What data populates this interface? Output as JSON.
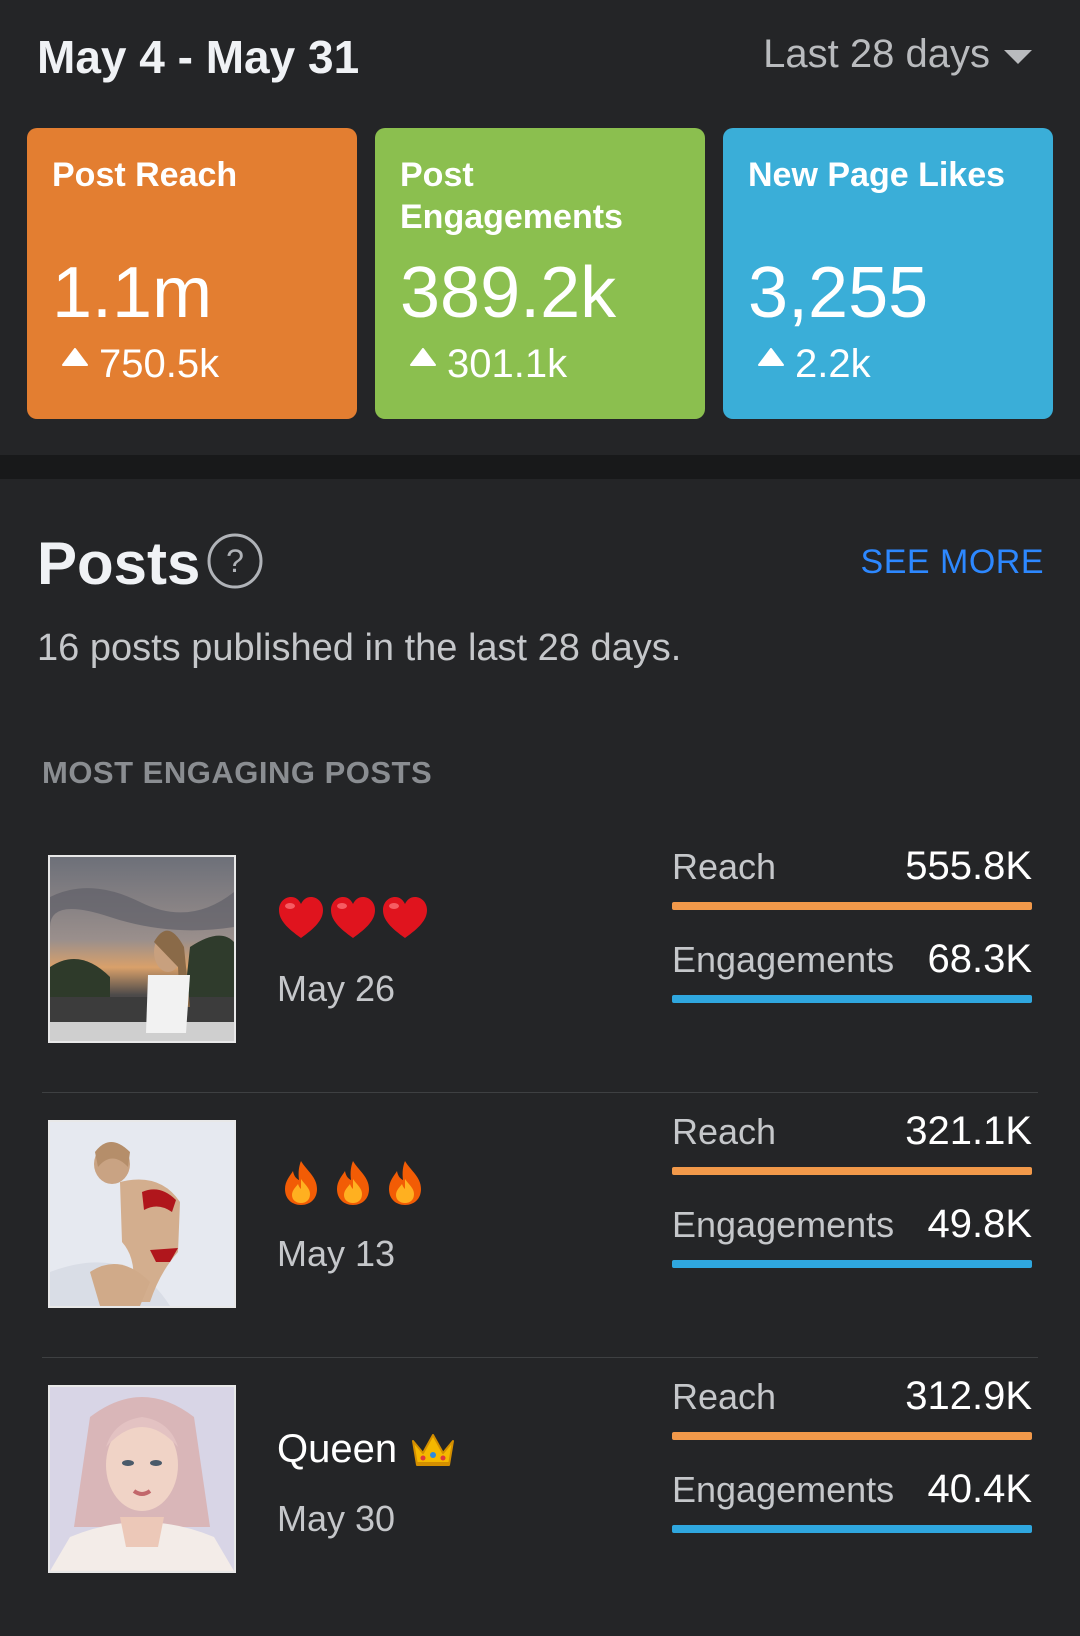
{
  "header": {
    "date_range": "May 4 - May 31",
    "period": "Last 28 days"
  },
  "summary_cards": [
    {
      "label": "Post Reach",
      "value": "1.1m",
      "delta": "750.5k",
      "color": "#e37e31"
    },
    {
      "label": "Post Engagements",
      "value": "389.2k",
      "delta": "301.1k",
      "color": "#8bbf4f"
    },
    {
      "label": "New Page Likes",
      "value": "3,255",
      "delta": "2.2k",
      "color": "#3aaed8"
    }
  ],
  "posts": {
    "title": "Posts",
    "see_more": "SEE MORE",
    "subtitle": "16 posts published in the last 28 days.",
    "section_label": "MOST ENGAGING POSTS",
    "reach_label": "Reach",
    "engagements_label": "Engagements",
    "items": [
      {
        "title_icons": [
          "heart-icon",
          "heart-icon",
          "heart-icon"
        ],
        "title": "",
        "date": "May 26",
        "reach": "555.8K",
        "engagements": "68.3K"
      },
      {
        "title_icons": [
          "fire-icon",
          "fire-icon",
          "fire-icon"
        ],
        "title": "",
        "date": "May 13",
        "reach": "321.1K",
        "engagements": "49.8K"
      },
      {
        "title_icons": [
          "crown-icon"
        ],
        "title": "Queen",
        "date": "May 30",
        "reach": "312.9K",
        "engagements": "40.4K"
      }
    ]
  }
}
